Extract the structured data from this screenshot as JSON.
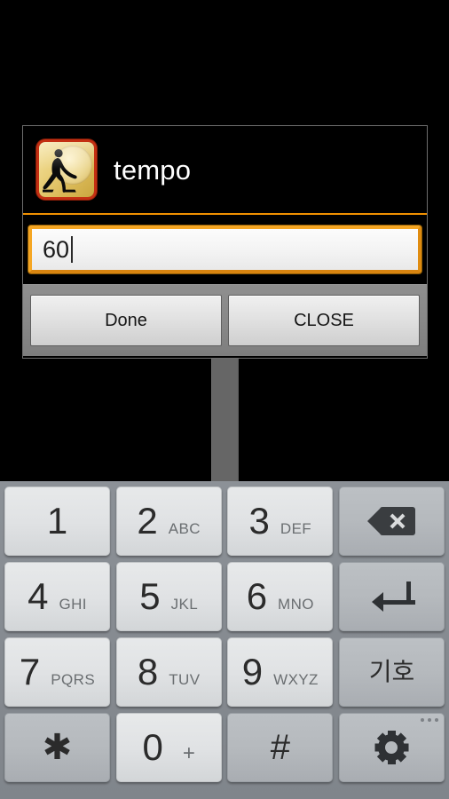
{
  "dialog": {
    "title": "tempo",
    "app_icon": "yoga-clock-icon",
    "input": {
      "value": "60",
      "placeholder": ""
    },
    "buttons": {
      "done_label": "Done",
      "close_label": "CLOSE"
    }
  },
  "keyboard": {
    "rows": [
      [
        {
          "digit": "1",
          "letters": "",
          "type": "light",
          "name": "key-1"
        },
        {
          "digit": "2",
          "letters": "ABC",
          "type": "light",
          "name": "key-2"
        },
        {
          "digit": "3",
          "letters": "DEF",
          "type": "light",
          "name": "key-3"
        },
        {
          "digit": "",
          "letters": "",
          "type": "dark",
          "name": "backspace-key",
          "icon": "backspace-icon"
        }
      ],
      [
        {
          "digit": "4",
          "letters": "GHI",
          "type": "light",
          "name": "key-4"
        },
        {
          "digit": "5",
          "letters": "JKL",
          "type": "light",
          "name": "key-5"
        },
        {
          "digit": "6",
          "letters": "MNO",
          "type": "light",
          "name": "key-6"
        },
        {
          "digit": "",
          "letters": "",
          "type": "dark",
          "name": "enter-key",
          "icon": "enter-icon"
        }
      ],
      [
        {
          "digit": "7",
          "letters": "PQRS",
          "type": "light",
          "name": "key-7"
        },
        {
          "digit": "8",
          "letters": "TUV",
          "type": "light",
          "name": "key-8"
        },
        {
          "digit": "9",
          "letters": "WXYZ",
          "type": "light",
          "name": "key-9"
        },
        {
          "digit": "",
          "letters": "",
          "type": "dark",
          "name": "symbol-key",
          "label": "기호"
        }
      ],
      [
        {
          "digit": "*",
          "letters": "",
          "type": "dark",
          "name": "key-asterisk"
        },
        {
          "digit": "0",
          "letters": "+",
          "type": "light",
          "name": "key-0"
        },
        {
          "digit": "#",
          "letters": "",
          "type": "dark",
          "name": "key-hash"
        },
        {
          "digit": "",
          "letters": "",
          "type": "dark",
          "name": "settings-key",
          "icon": "gear-icon"
        }
      ]
    ],
    "key_labels": {
      "symbol": "기호",
      "asterisk": "✱",
      "hash": "#",
      "zero": "0",
      "plus": "+"
    }
  },
  "colors": {
    "accent_orange": "#f5a623",
    "dialog_bg": "#000000",
    "button_bar": "#888888",
    "keyboard_bg": "#868b91",
    "key_light": "#e0e2e4",
    "key_dark": "#b5b9bd"
  }
}
